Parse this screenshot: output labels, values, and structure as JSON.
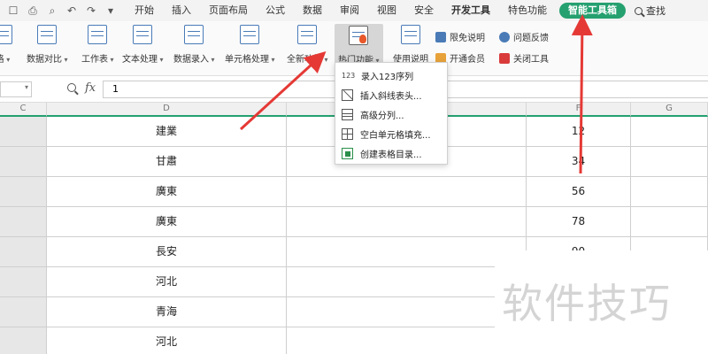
{
  "menubar": {
    "quick_access_icons": [
      "open-icon",
      "print-icon",
      "preview-icon",
      "undo-icon",
      "redo-icon",
      "dropdown-icon"
    ],
    "items": [
      "开始",
      "插入",
      "页面布局",
      "公式",
      "数据",
      "审阅",
      "视图",
      "安全",
      "开发工具",
      "特色功能"
    ],
    "active_tab": "智能工具箱",
    "search_label": "查找"
  },
  "ribbon": {
    "tools": [
      {
        "label": "格"
      },
      {
        "label": "数据对比"
      },
      {
        "label": "工作表"
      },
      {
        "label": "文本处理"
      },
      {
        "label": "数据录入"
      },
      {
        "label": "单元格处理"
      },
      {
        "label": "全新功能"
      },
      {
        "label": "热门功能"
      },
      {
        "label": "使用说明"
      }
    ],
    "side_buttons": {
      "limit_free": "限免说明",
      "open_member": "开通会员",
      "feedback": "问题反馈",
      "close_tool": "关闭工具"
    }
  },
  "formula_bar": {
    "fx": "fx",
    "value": "1"
  },
  "dropdown": {
    "items": [
      {
        "icon": "sequence-icon",
        "glyph": "123",
        "label": "录入123序列"
      },
      {
        "icon": "diagonal-header-icon",
        "label": "插入斜线表头..."
      },
      {
        "icon": "advanced-split-icon",
        "label": "高级分列..."
      },
      {
        "icon": "fill-blank-icon",
        "label": "空白单元格填充..."
      },
      {
        "icon": "table-directory-icon",
        "label": "创建表格目录..."
      }
    ]
  },
  "sheet": {
    "columns": [
      "C",
      "D",
      "",
      "F",
      "G"
    ],
    "rows": [
      {
        "d": "建業",
        "f": "12"
      },
      {
        "d": "甘肅",
        "f": "34"
      },
      {
        "d": "廣東",
        "f": "56"
      },
      {
        "d": "廣東",
        "f": "78"
      },
      {
        "d": "長安",
        "f": "90"
      },
      {
        "d": "河北",
        "f": ""
      },
      {
        "d": "青海",
        "f": ""
      },
      {
        "d": "河北",
        "f": ""
      }
    ]
  },
  "watermark": "软件技巧",
  "colors": {
    "accent": "#25a06f",
    "arrow": "#e53935",
    "grid": "#cfcfcf"
  }
}
